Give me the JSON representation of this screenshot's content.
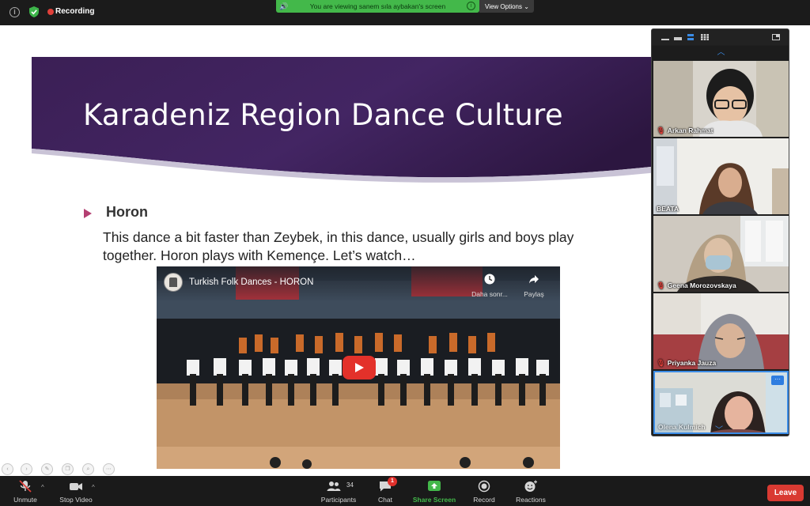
{
  "topbar": {
    "recording_label": "Recording",
    "share_banner_text": "You are viewing sanem sıla aybakan's screen",
    "view_options_label": "View Options ⌄"
  },
  "slide": {
    "title": "Karadeniz Region Dance Culture",
    "bullet_title": "Horon",
    "body_line1": " This dance a bit faster than Zeybek, in this dance, usually girls and boys play",
    "body_line2": "together. Horon plays with Kemençe. Let’s watch…"
  },
  "video": {
    "title": "Turkish Folk Dances - HORON",
    "watch_later_label": "Daha sonr...",
    "share_label": "Paylaş"
  },
  "gallery": {
    "participants": [
      {
        "name": "Arkan Rahmat",
        "muted": true
      },
      {
        "name": "BEATA",
        "muted": false
      },
      {
        "name": "Geena Morozovskaya",
        "muted": true
      },
      {
        "name": "Priyanka Jauza",
        "muted": true
      },
      {
        "name": "Olena Kulmich",
        "muted": false
      }
    ]
  },
  "toolbar": {
    "unmute_label": "Unmute",
    "stop_video_label": "Stop Video",
    "participants_label": "Participants",
    "participants_count": "34",
    "chat_label": "Chat",
    "chat_badge": "1",
    "share_screen_label": "Share Screen",
    "record_label": "Record",
    "reactions_label": "Reactions",
    "leave_label": "Leave"
  },
  "colors": {
    "accent_green": "#43b84a",
    "leave_red": "#d93a32",
    "banner_purple": "#3d2059",
    "bullet_pink": "#b43f72"
  }
}
